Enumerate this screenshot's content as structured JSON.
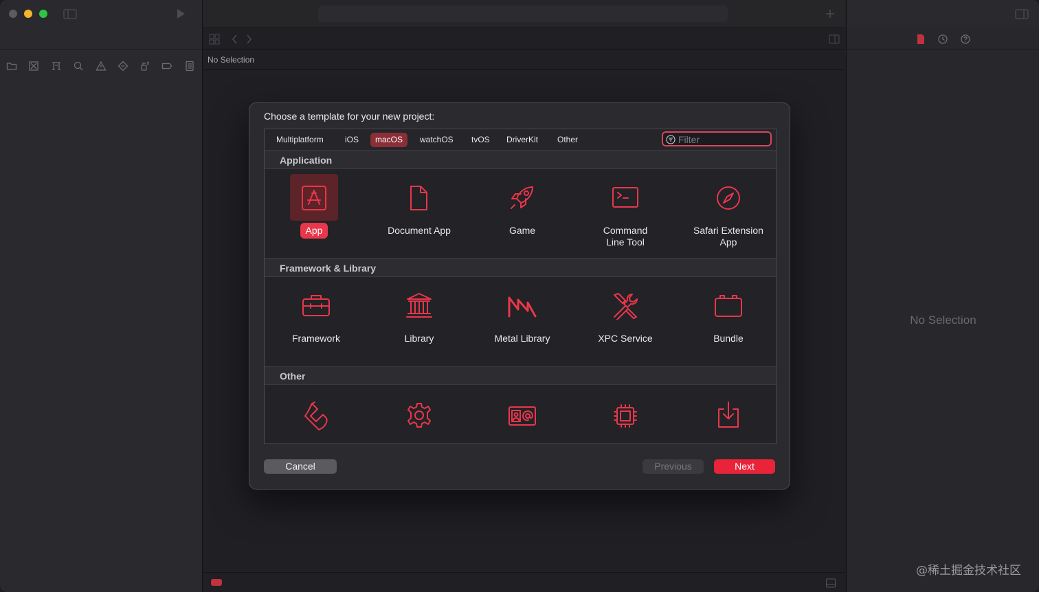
{
  "window": {
    "traffic_lights": [
      "close",
      "minimize",
      "zoom"
    ]
  },
  "editor": {
    "jump_bar_text": "No Selection"
  },
  "inspector": {
    "empty_text": "No Selection"
  },
  "dialog": {
    "title": "Choose a template for your new project:",
    "tabs": [
      "Multiplatform",
      "iOS",
      "macOS",
      "watchOS",
      "tvOS",
      "DriverKit",
      "Other"
    ],
    "selected_tab": "macOS",
    "filter": {
      "placeholder": "Filter",
      "value": ""
    },
    "sections": [
      {
        "title": "Application",
        "items": [
          {
            "label": "App",
            "icon": "app-store-icon",
            "selected": true
          },
          {
            "label": "Document App",
            "icon": "document-icon",
            "selected": false
          },
          {
            "label": "Game",
            "icon": "rocket-icon",
            "selected": false
          },
          {
            "label": "Command Line Tool",
            "icon": "terminal-icon",
            "selected": false
          },
          {
            "label": "Safari Extension App",
            "icon": "compass-icon",
            "selected": false
          }
        ]
      },
      {
        "title": "Framework & Library",
        "items": [
          {
            "label": "Framework",
            "icon": "toolbox-icon"
          },
          {
            "label": "Library",
            "icon": "columns-building-icon"
          },
          {
            "label": "Metal Library",
            "icon": "metal-icon"
          },
          {
            "label": "XPC Service",
            "icon": "tools-icon"
          },
          {
            "label": "Bundle",
            "icon": "bundle-icon"
          }
        ]
      },
      {
        "title": "Other",
        "items": [
          {
            "icon": "plugin-icon"
          },
          {
            "icon": "gear-icon"
          },
          {
            "icon": "contact-card-icon"
          },
          {
            "icon": "chip-icon"
          },
          {
            "icon": "installer-icon"
          }
        ]
      }
    ],
    "buttons": {
      "cancel": "Cancel",
      "previous": "Previous",
      "next": "Next"
    }
  },
  "watermark": "@稀土掘金技术社区",
  "colors": {
    "accent": "#e8374a",
    "selected_tab_bg": "#8a2f38",
    "next_button": "#e8233a",
    "background": "#1f1f24"
  }
}
